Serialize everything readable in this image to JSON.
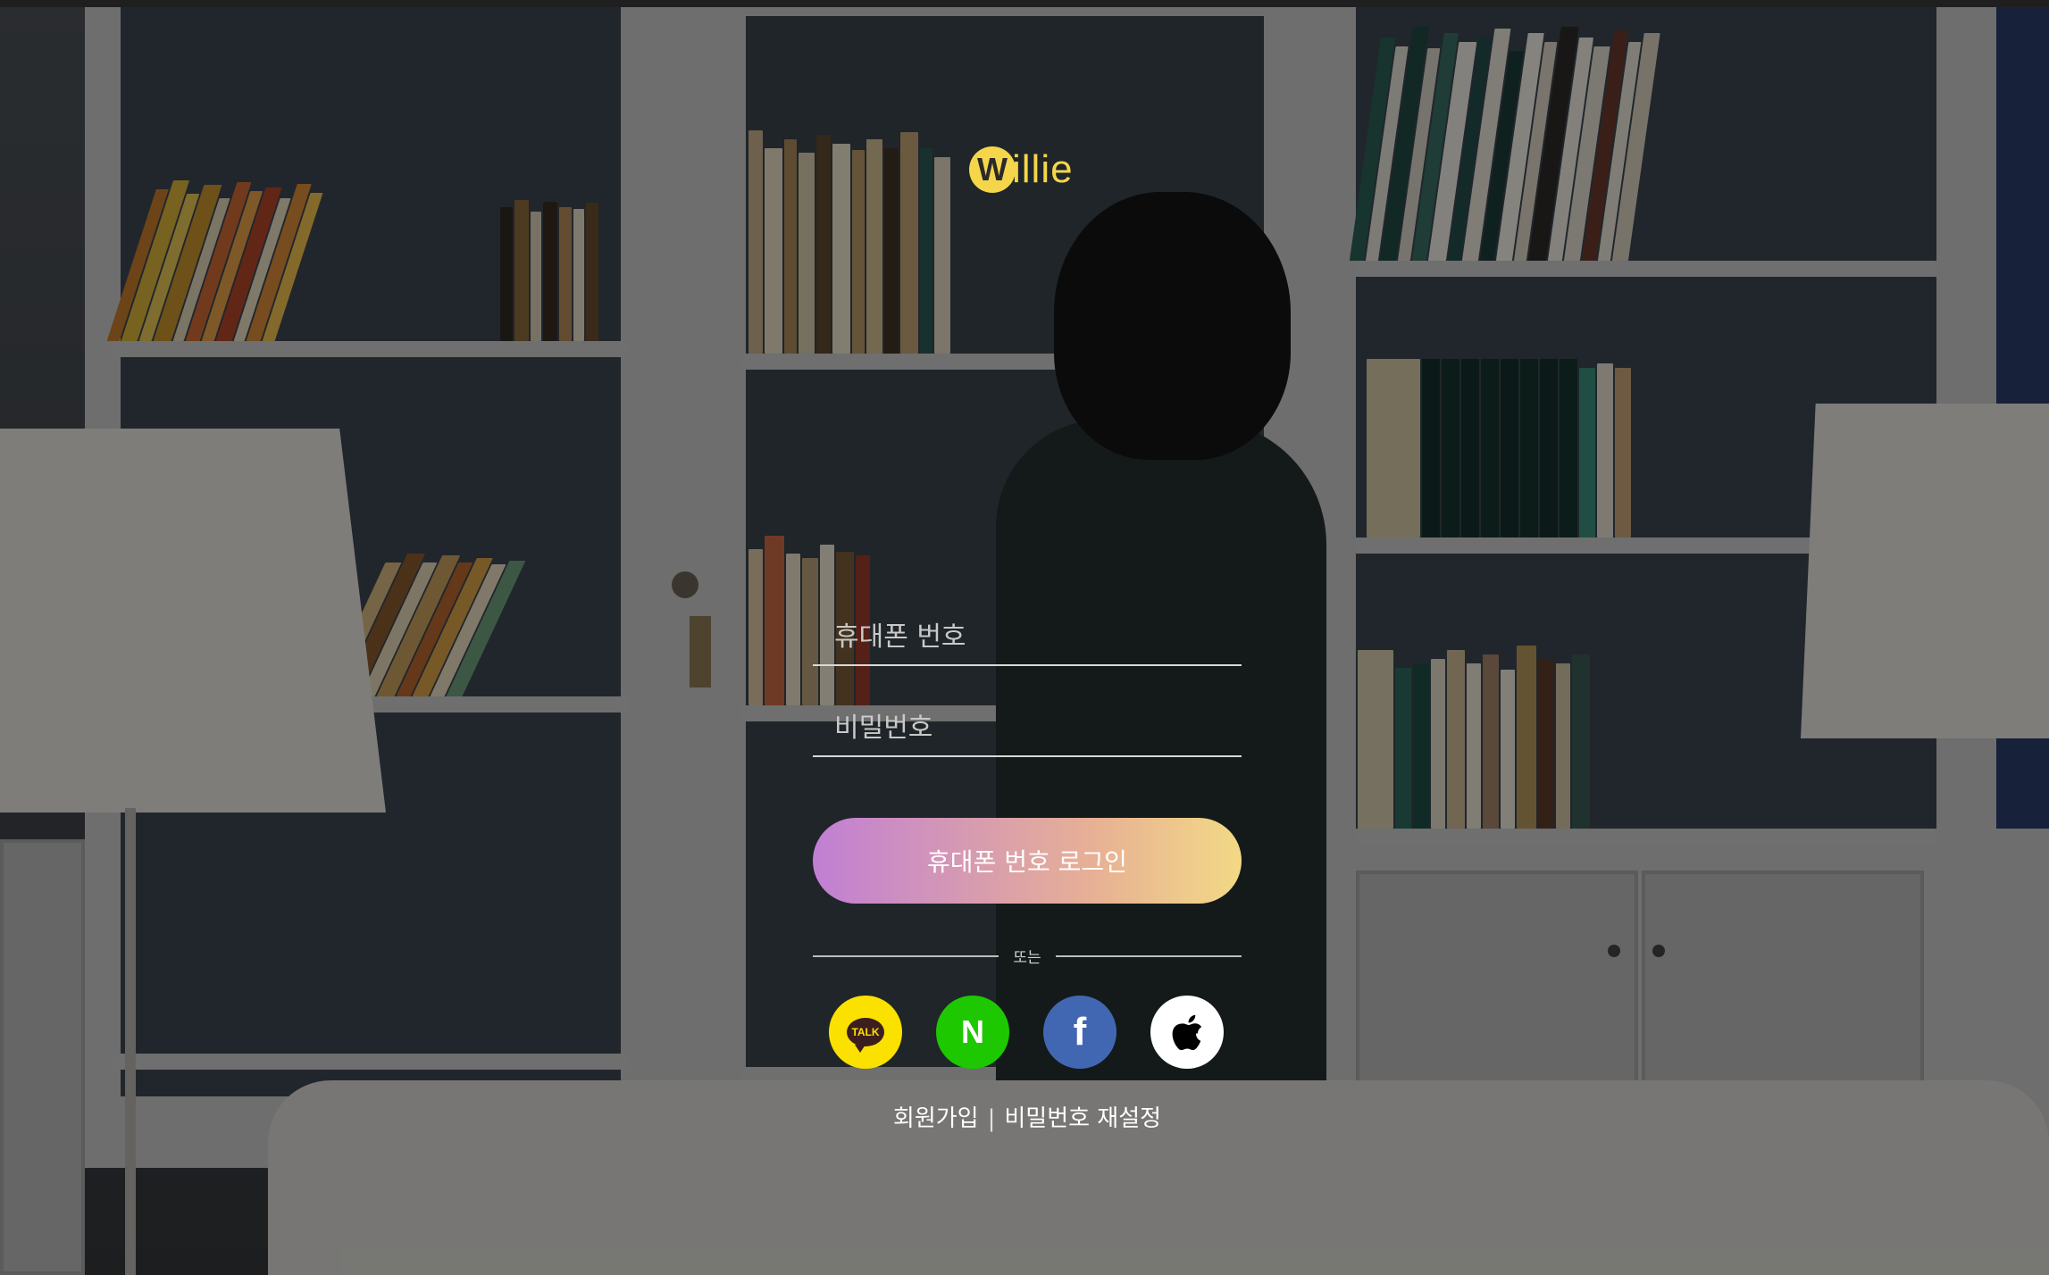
{
  "brand": {
    "logo_w": "W",
    "logo_text": "illie",
    "accent": "#f5d64a"
  },
  "form": {
    "phone_placeholder": "휴대폰 번호",
    "password_placeholder": "비밀번호",
    "login_label": "휴대폰 번호 로그인",
    "login_gradient": [
      "#c17fd4",
      "#f2d985"
    ]
  },
  "divider": {
    "text": "또는"
  },
  "social": [
    {
      "name": "kakao",
      "label": "TALK",
      "color": "#fae100"
    },
    {
      "name": "naver",
      "label": "N",
      "color": "#1ec800"
    },
    {
      "name": "facebook",
      "label": "f",
      "color": "#4267b2"
    },
    {
      "name": "apple",
      "icon": "apple-icon",
      "color": "#ffffff"
    }
  ],
  "links": {
    "signup": "회원가입",
    "separator": "|",
    "reset_password": "비밀번호 재설정"
  }
}
